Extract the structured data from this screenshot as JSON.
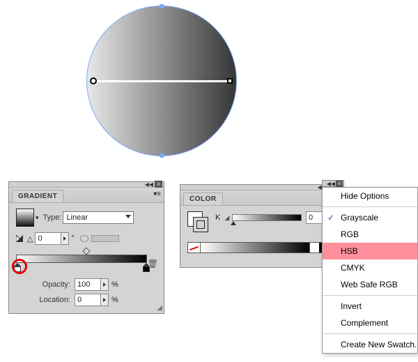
{
  "gradient_panel": {
    "tab": "GRADIENT",
    "type_label": "Type:",
    "type_value": "Linear",
    "angle_value": "0",
    "degree": "°",
    "opacity_label": "Opacity:",
    "opacity_value": "100",
    "percent": "%",
    "location_label": "Location:",
    "location_value": "0"
  },
  "color_panel": {
    "tab": "COLOR",
    "channel_label": "K",
    "channel_value": "0"
  },
  "context_menu": {
    "items": [
      {
        "label": "Hide Options",
        "checked": false,
        "selected": false
      },
      {
        "label": "Grayscale",
        "checked": true,
        "selected": false
      },
      {
        "label": "RGB",
        "checked": false,
        "selected": false
      },
      {
        "label": "HSB",
        "checked": false,
        "selected": true
      },
      {
        "label": "CMYK",
        "checked": false,
        "selected": false
      },
      {
        "label": "Web Safe RGB",
        "checked": false,
        "selected": false
      },
      {
        "label": "Invert",
        "checked": false,
        "selected": false
      },
      {
        "label": "Complement",
        "checked": false,
        "selected": false
      },
      {
        "label": "Create New Swatch...",
        "checked": false,
        "selected": false
      }
    ]
  }
}
